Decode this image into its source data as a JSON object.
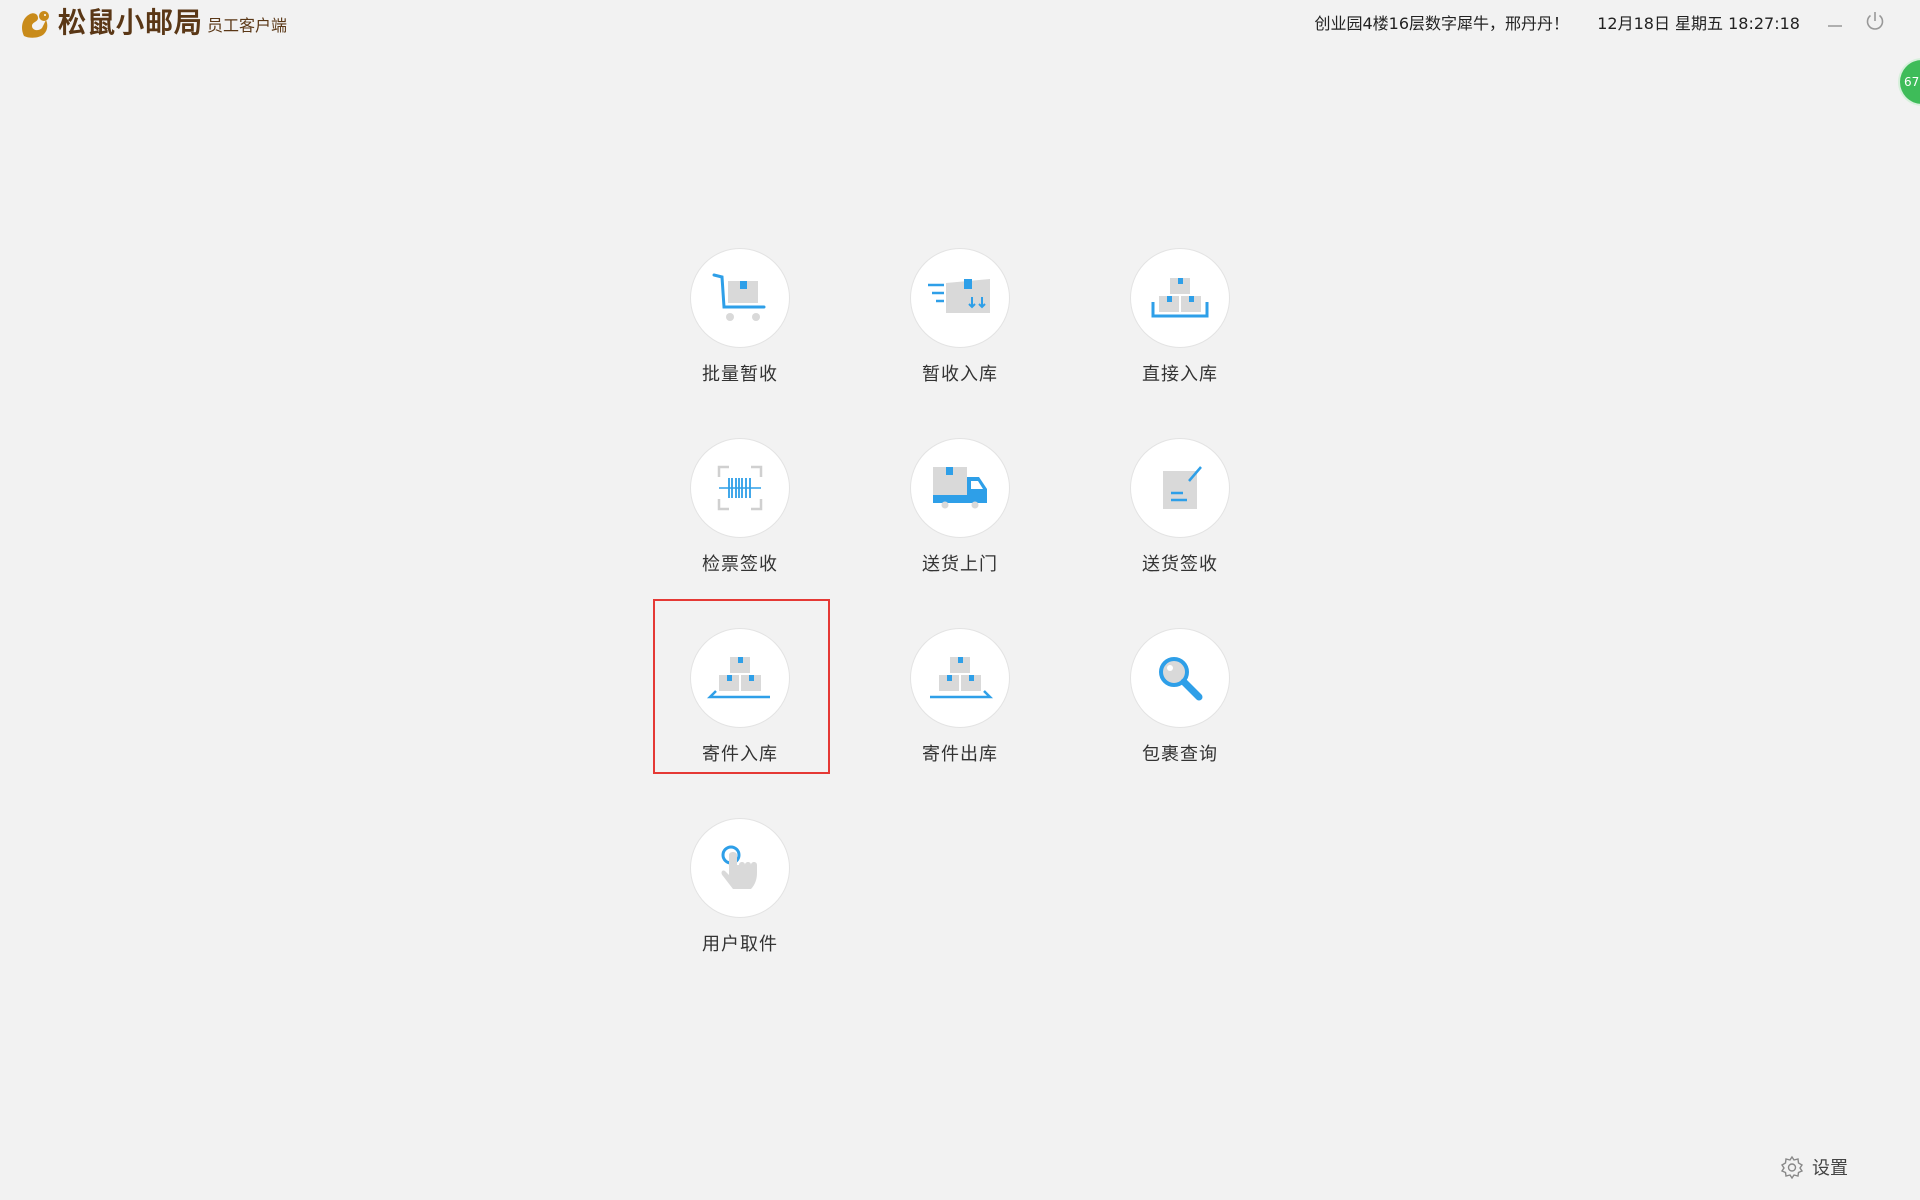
{
  "app": {
    "name": "松鼠小邮局",
    "subtitle": "员工客户端",
    "logo_icon": "squirrel-logo-icon"
  },
  "header": {
    "location_greeting": "创业园4楼16层数字犀牛，邢丹丹！",
    "datetime": "12月18日 星期五 18:27:18",
    "minimize_icon": "minimize-icon",
    "power_icon": "power-icon"
  },
  "badge": {
    "text": "67"
  },
  "tiles": [
    {
      "label": "批量暂收",
      "icon": "cart-icon"
    },
    {
      "label": "暂收入库",
      "icon": "incoming-package-icon"
    },
    {
      "label": "直接入库",
      "icon": "boxes-tray-icon"
    },
    {
      "label": "检票签收",
      "icon": "barcode-scan-icon"
    },
    {
      "label": "送货上门",
      "icon": "delivery-truck-icon"
    },
    {
      "label": "送货签收",
      "icon": "sign-document-icon"
    },
    {
      "label": "寄件入库",
      "icon": "boxes-stack-icon"
    },
    {
      "label": "寄件出库",
      "icon": "boxes-outbound-icon"
    },
    {
      "label": "包裹查询",
      "icon": "magnifier-icon"
    },
    {
      "label": "用户取件",
      "icon": "tap-hand-icon"
    }
  ],
  "settings": {
    "label": "设置",
    "icon": "gear-icon"
  },
  "colors": {
    "accent": "#2e9fe8",
    "gray": "#d9d9d9",
    "brand": "#5a3716",
    "highlight": "#e53935"
  }
}
